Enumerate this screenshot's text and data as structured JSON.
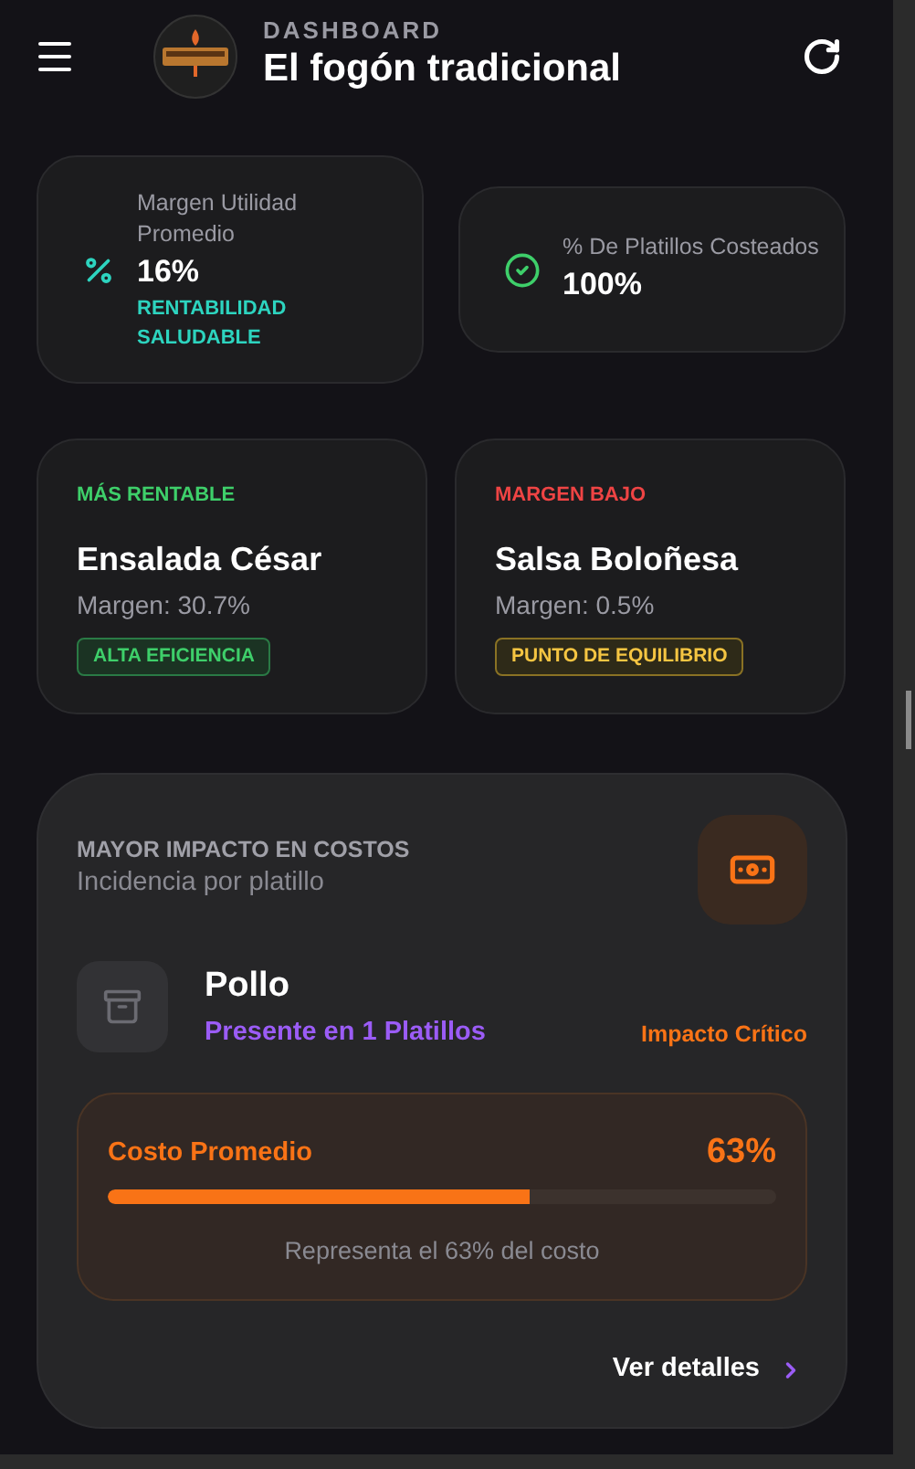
{
  "header": {
    "eyebrow": "DASHBOARD",
    "title": "El fogón tradicional"
  },
  "stats": [
    {
      "kind": "percent",
      "label": "Margen Utilidad Promedio",
      "value": "16%",
      "note": "RENTABILIDAD SALUDABLE"
    },
    {
      "kind": "check",
      "label": "% De Platillos Costeados",
      "value": "100%"
    }
  ],
  "highlights": [
    {
      "kind": "best",
      "tag": "MÁS RENTABLE",
      "name": "Ensalada César",
      "margin": "Margen: 30.7%",
      "badge": "ALTA EFICIENCIA"
    },
    {
      "kind": "low",
      "tag": "MARGEN BAJO",
      "name": "Salsa Boloñesa",
      "margin": "Margen: 0.5%",
      "badge": "PUNTO DE EQUILIBRIO"
    }
  ],
  "impact": {
    "title": "MAYOR IMPACTO EN COSTOS",
    "subtitle": "Incidencia por platillo",
    "item": "Pollo",
    "presence": "Presente en 1 Platillos",
    "severity": "Impacto Crítico",
    "cost_label": "Costo Promedio",
    "cost_value": "63%",
    "level": 0.63,
    "caption": "Representa el 63% del costo",
    "link": "Ver detalles"
  }
}
